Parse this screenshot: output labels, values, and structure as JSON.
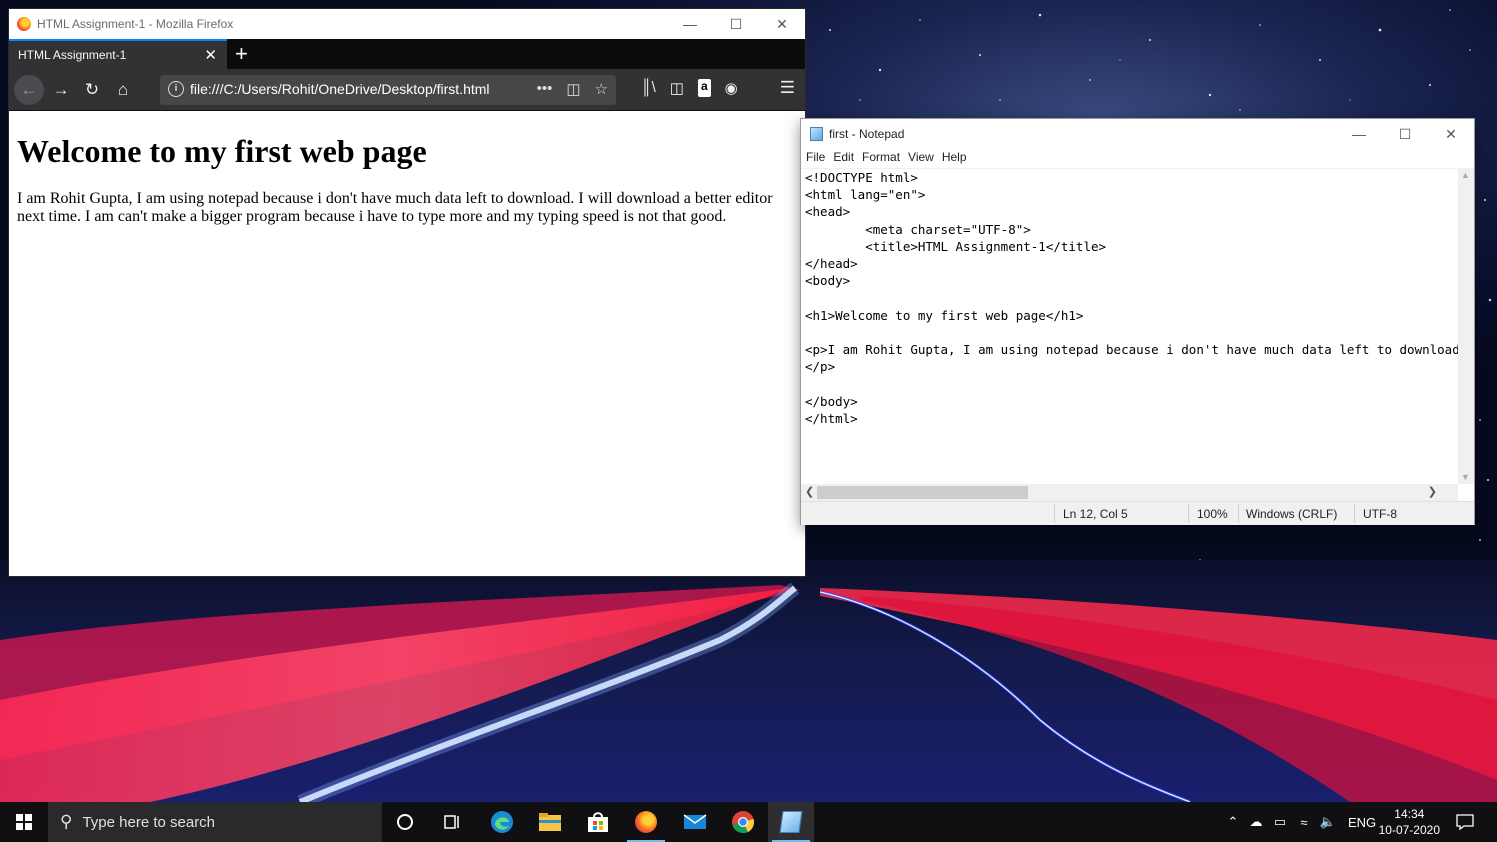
{
  "firefox": {
    "window_title": "HTML Assignment-1 - Mozilla Firefox",
    "tab_label": "HTML Assignment-1",
    "url": "file:///C:/Users/Rohit/OneDrive/Desktop/first.html",
    "page": {
      "heading": "Welcome to my first web page",
      "paragraph": "I am Rohit Gupta, I am using notepad because i don't have much data left to download. I will download a better editor next time. I am can't make a bigger program because i have to type more and my typing speed is not that good."
    }
  },
  "notepad": {
    "window_title": "first - Notepad",
    "menu": [
      "File",
      "Edit",
      "Format",
      "View",
      "Help"
    ],
    "code_lines": [
      "<!DOCTYPE html>",
      "<html lang=\"en\">",
      "<head>",
      "        <meta charset=\"UTF-8\">",
      "        <title>HTML Assignment-1</title>",
      "</head>",
      "<body>",
      "",
      "<h1>Welcome to my first web page</h1>",
      "",
      "<p>I am Rohit Gupta, I am using notepad because i don't have much data left to download.",
      "</p>",
      "",
      "</body>",
      "</html>"
    ],
    "status": {
      "position": "Ln 12, Col 5",
      "zoom": "100%",
      "line_ending": "Windows (CRLF)",
      "encoding": "UTF-8"
    }
  },
  "taskbar": {
    "search_placeholder": "Type here to search",
    "language": "ENG",
    "time": "14:34",
    "date": "10-07-2020"
  },
  "colors": {
    "firefox_chrome": "#323234",
    "firefox_tab_accent": "#0a84ff",
    "taskbar": "#101013",
    "taskbar_active": "#76b9ed"
  }
}
